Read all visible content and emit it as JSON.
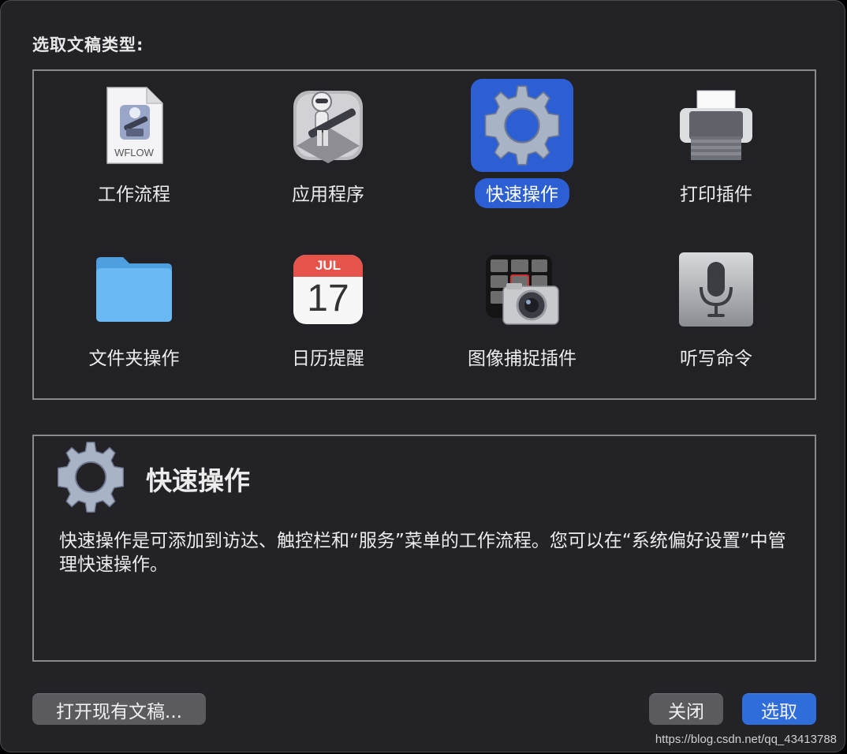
{
  "dialog": {
    "prompt": "选取文稿类型:"
  },
  "types": [
    {
      "label": "工作流程",
      "icon": "workflow-file-icon",
      "file_badge": "WFLOW",
      "selected": false
    },
    {
      "label": "应用程序",
      "icon": "automator-robot-icon",
      "selected": false
    },
    {
      "label": "快速操作",
      "icon": "gear-icon",
      "selected": true
    },
    {
      "label": "打印插件",
      "icon": "printer-icon",
      "selected": false
    },
    {
      "label": "文件夹操作",
      "icon": "folder-icon",
      "selected": false
    },
    {
      "label": "日历提醒",
      "icon": "calendar-icon",
      "calendar_month": "JUL",
      "calendar_day": "17",
      "selected": false
    },
    {
      "label": "图像捕捉插件",
      "icon": "image-capture-icon",
      "selected": false
    },
    {
      "label": "听写命令",
      "icon": "microphone-icon",
      "selected": false
    }
  ],
  "description": {
    "icon": "gear-icon",
    "title": "快速操作",
    "text": "快速操作是可添加到访达、触控栏和“服务”菜单的工作流程。您可以在“系统偏好设置”中管理快速操作。"
  },
  "buttons": {
    "open_existing": "打开现有文稿...",
    "close": "关闭",
    "choose": "选取"
  },
  "watermark": "https://blog.csdn.net/qq_43413788",
  "colors": {
    "accent": "#2c5fd3",
    "background": "#232227",
    "border": "#8a8a8e"
  }
}
